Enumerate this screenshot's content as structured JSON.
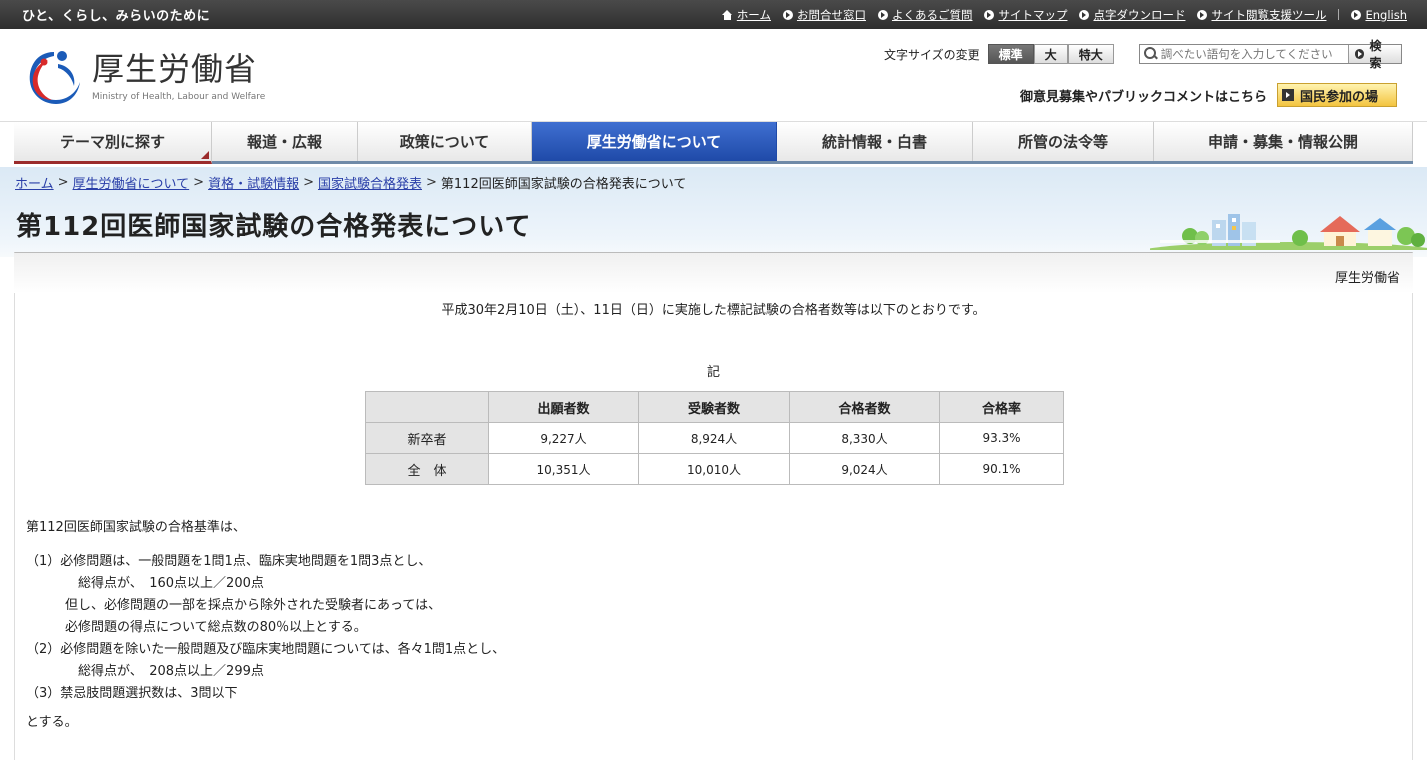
{
  "topbar": {
    "tagline": "ひと、くらし、みらいのために",
    "links": [
      {
        "label": "ホーム",
        "icon": "home-icon"
      },
      {
        "label": "お問合せ窓口",
        "icon": "arrow-circle-icon"
      },
      {
        "label": "よくあるご質問",
        "icon": "arrow-circle-icon"
      },
      {
        "label": "サイトマップ",
        "icon": "arrow-circle-icon"
      },
      {
        "label": "点字ダウンロード",
        "icon": "arrow-circle-icon"
      },
      {
        "label": "サイト閲覧支援ツール",
        "icon": "arrow-circle-icon"
      }
    ],
    "english": "English"
  },
  "header": {
    "logo_jp": "厚生労働省",
    "logo_en": "Ministry of Health, Labour and Welfare",
    "fontsize_label": "文字サイズの変更",
    "fontsize_options": [
      "標準",
      "大",
      "特大"
    ],
    "fontsize_selected": "標準",
    "search_placeholder": "調べたい語句を入力してください",
    "search_button": "検索",
    "public_text": "御意見募集やパブリックコメントはこちら",
    "public_button": "国民参加の場"
  },
  "nav": [
    {
      "label": "テーマ別に探す"
    },
    {
      "label": "報道・広報"
    },
    {
      "label": "政策について"
    },
    {
      "label": "厚生労働省について"
    },
    {
      "label": "統計情報・白書"
    },
    {
      "label": "所管の法令等"
    },
    {
      "label": "申請・募集・情報公開"
    }
  ],
  "breadcrumb": {
    "items": [
      "ホーム",
      "厚生労働省について",
      "資格・試験情報",
      "国家試験合格発表"
    ],
    "current": "第112回医師国家試験の合格発表について"
  },
  "page_title": "第112回医師国家試験の合格発表について",
  "content": {
    "org": "厚生労働省",
    "lead": "平成30年2月10日（土）、11日（日）に実施した標記試験の合格者数等は以下のとおりです。",
    "ki": "記",
    "table": {
      "headers": [
        "",
        "出願者数",
        "受験者数",
        "合格者数",
        "合格率"
      ],
      "rows": [
        [
          "新卒者",
          "9,227人",
          "8,924人",
          "8,330人",
          "93.3%"
        ],
        [
          "全　体",
          "10,351人",
          "10,010人",
          "9,024人",
          "90.1%"
        ]
      ]
    },
    "criteria_intro": "第112回医師国家試験の合格基準は、",
    "criteria_lines": [
      "（1）必修問題は、一般問題を1問1点、臨床実地問題を1問3点とし、",
      "　　　　総得点が、　160点以上／200点",
      "　　　但し、必修問題の一部を採点から除外された受験者にあっては、",
      "　　　必修問題の得点について総点数の80％以上とする。",
      "（2）必修問題を除いた一般問題及び臨床実地問題については、各々1問1点とし、",
      "　　　　総得点が、　208点以上／299点",
      "（3）禁忌肢問題選択数は、3問以下"
    ],
    "ending": "とする。"
  }
}
